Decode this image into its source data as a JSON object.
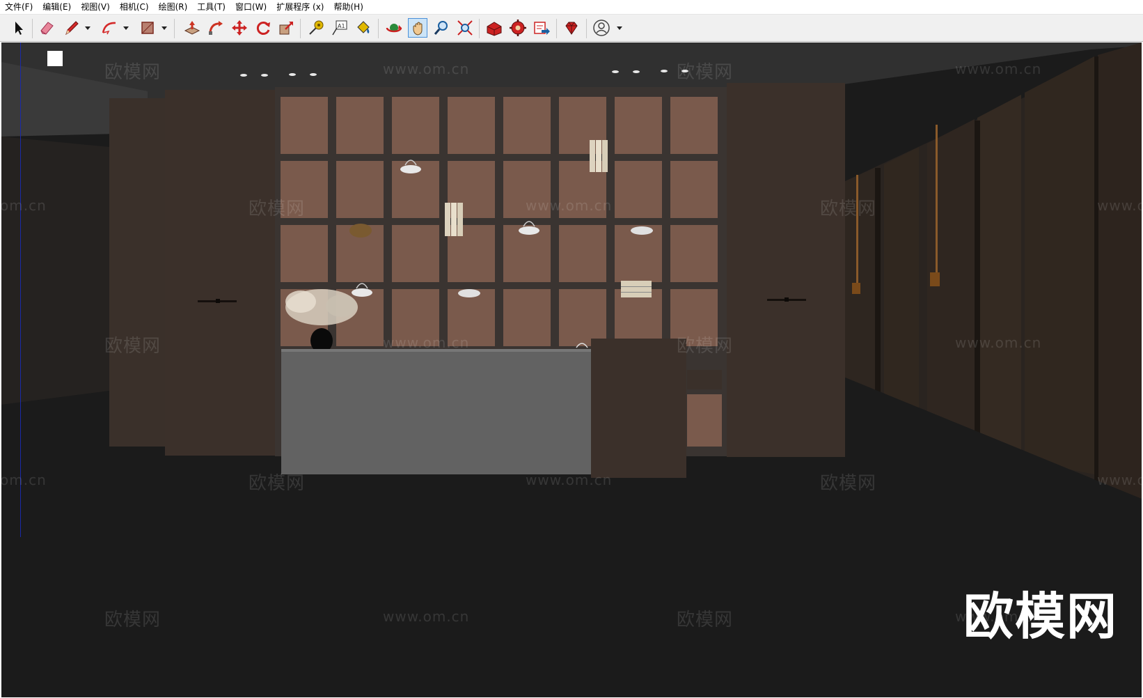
{
  "menu": [
    "文件(F)",
    "编辑(E)",
    "视图(V)",
    "相机(C)",
    "绘图(R)",
    "工具(T)",
    "窗口(W)",
    "扩展程序 (x)",
    "帮助(H)"
  ],
  "toolbar": {
    "tools": [
      {
        "name": "select-icon",
        "color": "#111111"
      },
      {
        "name": "eraser-icon",
        "color": "#e0607a"
      },
      {
        "name": "pencil-icon",
        "color": "#d42a2a"
      },
      {
        "name": "arc-icon",
        "color": "#d42a2a"
      },
      {
        "name": "rectangle-icon",
        "color": "#b5473c"
      },
      {
        "name": "push-pull-icon",
        "color": "#cc3322"
      },
      {
        "name": "follow-me-icon",
        "color": "#cc3322"
      },
      {
        "name": "move-icon",
        "color": "#cc2222"
      },
      {
        "name": "rotate-icon",
        "color": "#cc2222"
      },
      {
        "name": "scale-icon",
        "color": "#cc2222"
      },
      {
        "name": "tape-measure-icon",
        "color": "#d4a800"
      },
      {
        "name": "text-icon",
        "color": "#333333"
      },
      {
        "name": "paint-bucket-icon",
        "color": "#d4a800"
      },
      {
        "name": "orbit-icon",
        "color": "#cc2222"
      },
      {
        "name": "pan-icon",
        "color": "#e8b464"
      },
      {
        "name": "zoom-icon",
        "color": "#1a5fa0"
      },
      {
        "name": "zoom-extents-icon",
        "color": "#cc2222"
      },
      {
        "name": "warehouse-icon",
        "color": "#cc2222"
      },
      {
        "name": "extension-warehouse-icon",
        "color": "#cc2222"
      },
      {
        "name": "send-to-layout-icon",
        "color": "#cc2222"
      },
      {
        "name": "extension-manager-icon",
        "color": "#cc2222"
      },
      {
        "name": "account-icon",
        "color": "#444444"
      }
    ],
    "active_tool": "pan-icon"
  },
  "watermark": {
    "text": "欧模网",
    "url": "www.om.cn",
    "url_partial_left": "om.cn",
    "url_partial_right": "www.o"
  },
  "brand_logo": "欧模网",
  "scene_colors": {
    "ceiling": "#303030",
    "floor": "#1b1b1b",
    "wood_dark": "#3b302a",
    "shelf_back": "#7a5a4c",
    "counter_top": "#636363"
  }
}
